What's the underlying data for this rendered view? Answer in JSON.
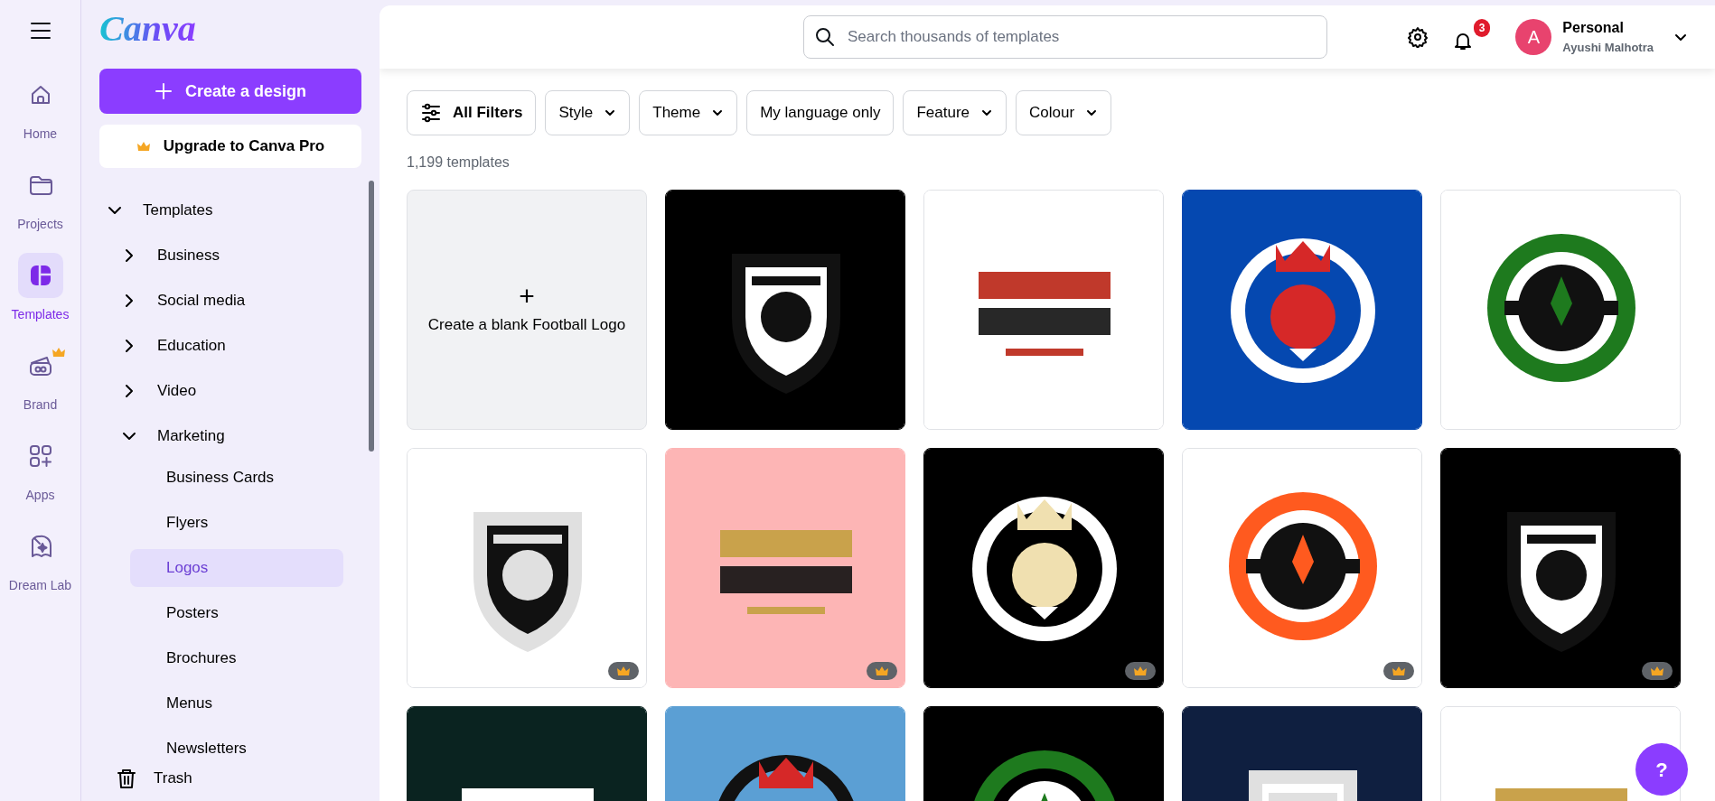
{
  "rail": {
    "items": [
      {
        "label": "Home",
        "selected": false,
        "premium": false
      },
      {
        "label": "Projects",
        "selected": false,
        "premium": false
      },
      {
        "label": "Templates",
        "selected": true,
        "premium": false
      },
      {
        "label": "Brand",
        "selected": false,
        "premium": true
      },
      {
        "label": "Apps",
        "selected": false,
        "premium": false
      },
      {
        "label": "Dream Lab",
        "selected": false,
        "premium": false
      }
    ]
  },
  "sidebar": {
    "logo": "Canva",
    "create_button": "Create a design",
    "upgrade_button": "Upgrade to Canva Pro",
    "tree": [
      {
        "label": "Templates",
        "expanded": true,
        "children": [
          {
            "label": "Business",
            "expanded": false
          },
          {
            "label": "Social media",
            "expanded": false
          },
          {
            "label": "Education",
            "expanded": false
          },
          {
            "label": "Video",
            "expanded": false
          },
          {
            "label": "Marketing",
            "expanded": true,
            "children": [
              {
                "label": "Business Cards",
                "selected": false
              },
              {
                "label": "Flyers",
                "selected": false
              },
              {
                "label": "Logos",
                "selected": true
              },
              {
                "label": "Posters",
                "selected": false
              },
              {
                "label": "Brochures",
                "selected": false
              },
              {
                "label": "Menus",
                "selected": false
              },
              {
                "label": "Newsletters",
                "selected": false
              }
            ]
          }
        ]
      }
    ],
    "trash": "Trash"
  },
  "topbar": {
    "search": {
      "placeholder": "Search thousands of templates"
    },
    "notifications": "3",
    "account": {
      "avatar": "A",
      "title": "Personal",
      "name": "Ayushi Malhotra"
    }
  },
  "filters": [
    {
      "label": "All Filters",
      "kind": "all"
    },
    {
      "label": "Style",
      "kind": "dropdown"
    },
    {
      "label": "Theme",
      "kind": "dropdown"
    },
    {
      "label": "My language only",
      "kind": "toggle"
    },
    {
      "label": "Feature",
      "kind": "dropdown"
    },
    {
      "label": "Colour",
      "kind": "dropdown"
    }
  ],
  "count": "1,199 templates",
  "templates": [
    {
      "kind": "blank",
      "label": "Create a blank Football Logo",
      "plus": "+"
    },
    {
      "kind": "picture",
      "premium": false
    },
    {
      "kind": "picture",
      "premium": false
    },
    {
      "kind": "picture",
      "premium": false
    },
    {
      "kind": "picture",
      "premium": false
    },
    {
      "kind": "picture",
      "premium": true
    },
    {
      "kind": "picture",
      "premium": true
    },
    {
      "kind": "picture",
      "premium": true
    },
    {
      "kind": "picture",
      "premium": true
    },
    {
      "kind": "picture",
      "premium": true
    },
    {
      "kind": "picture",
      "premium": false
    },
    {
      "kind": "picture",
      "premium": false
    },
    {
      "kind": "picture",
      "premium": false
    },
    {
      "kind": "picture",
      "premium": false
    },
    {
      "kind": "picture",
      "premium": false
    }
  ],
  "help_button": "?"
}
